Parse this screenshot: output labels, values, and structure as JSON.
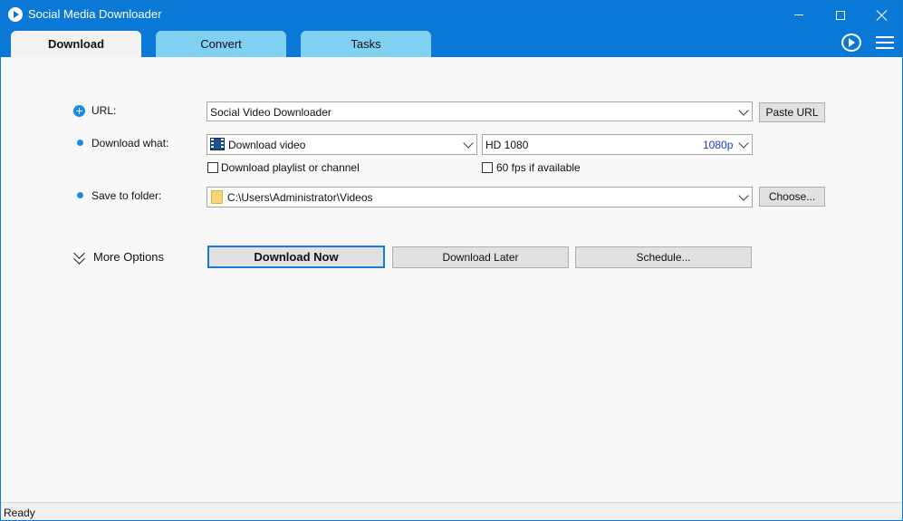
{
  "window": {
    "title": "Social Media Downloader"
  },
  "tabs": [
    {
      "label": "Download",
      "active": true
    },
    {
      "label": "Convert",
      "active": false
    },
    {
      "label": "Tasks",
      "active": false
    }
  ],
  "form": {
    "url_label": "URL:",
    "url_value": "Social Video Downloader",
    "paste_button": "Paste URL",
    "download_what_label": "Download what:",
    "download_type": "Download video",
    "quality_value": "HD 1080",
    "quality_tag": "1080p",
    "playlist_checkbox": "Download playlist or channel",
    "fps_checkbox": "60 fps if available",
    "folder_label": "Save to folder:",
    "folder_value": "C:\\Users\\Administrator\\Videos",
    "choose_button": "Choose..."
  },
  "actions": {
    "more_options": "More Options",
    "download_now": "Download Now",
    "download_later": "Download Later",
    "schedule": "Schedule..."
  },
  "status": {
    "text": "Ready"
  },
  "colors": {
    "titlebar": "#0a78d7",
    "tab_inactive": "#7fd0f1",
    "accent": "#1a8ae6",
    "quality_tag": "#1a3cc9"
  },
  "icons": [
    "app-icon",
    "minimize-icon",
    "maximize-icon",
    "close-icon",
    "help-play-icon",
    "hamburger-menu-icon",
    "plus-icon",
    "film-icon",
    "folder-icon",
    "chevron-down-icon"
  ]
}
